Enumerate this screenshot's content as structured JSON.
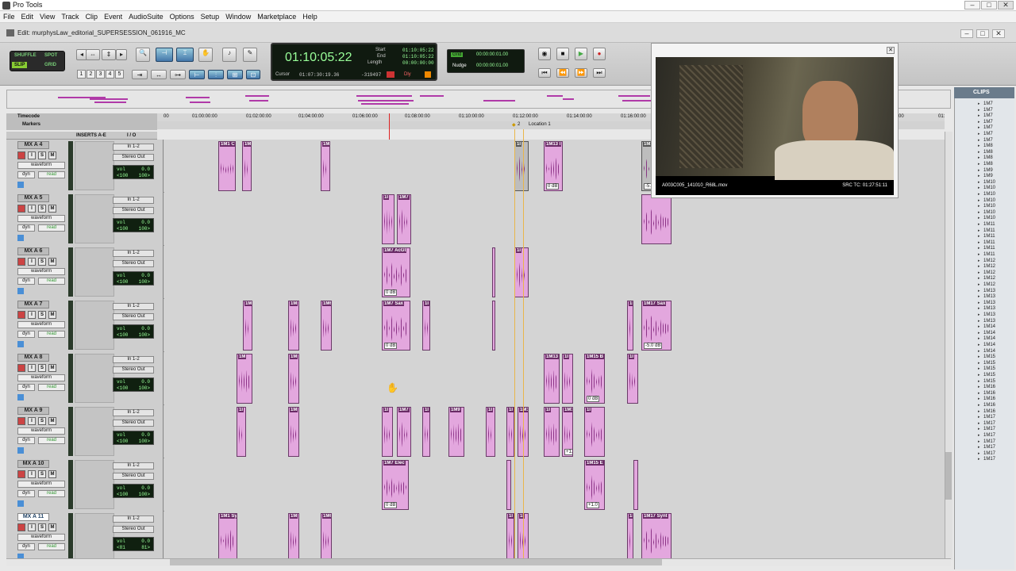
{
  "window": {
    "title": "Pro Tools",
    "edit_title": "Edit: murphysLaw_editorial_SUPERSESSION_061916_MC"
  },
  "menu": [
    "File",
    "Edit",
    "View",
    "Track",
    "Clip",
    "Event",
    "AudioSuite",
    "Options",
    "Setup",
    "Window",
    "Marketplace",
    "Help"
  ],
  "modes": {
    "shuffle": "SHUFFLE",
    "spot": "SPOT",
    "slip": "SLIP",
    "grid": "GRID"
  },
  "zoom_presets": [
    "1",
    "2",
    "3",
    "4",
    "5"
  ],
  "counter": {
    "main": "01:10:05:22",
    "start_label": "Start",
    "end_label": "End",
    "length_label": "Length",
    "start": "01:10:05:22",
    "end": "01:10:05:22",
    "length": "00:00:00:00",
    "cursor_label": "Cursor",
    "cursor": "01:07:30:19.36",
    "sample": "-319497",
    "dly_label": "Dly"
  },
  "grid": {
    "grid_label": "Grid",
    "grid_value": "00:00:00:01.00",
    "nudge_label": "Nudge",
    "nudge_value": "00:00:00:01.00"
  },
  "rulers": {
    "timecode_label": "Timecode",
    "markers_label": "Markers",
    "location": "2",
    "location_name": "Location 1",
    "ticks": [
      "00",
      "01:00:00:00",
      "01:02:00:00",
      "01:04:00:00",
      "01:06:00:00",
      "01:08:00:00",
      "01:10:00:00",
      "01:12:00:00",
      "01:14:00:00",
      "01:16:00:00",
      "00",
      "01:"
    ]
  },
  "columns": {
    "inserts": "INSERTS A-E",
    "io": "I / O"
  },
  "tracks": [
    {
      "name": "MX A 4",
      "input": "In 1-2",
      "output": "Stereo Out",
      "vol": "0.0",
      "pan_l": "<100",
      "pan_r": "100>",
      "selected": false
    },
    {
      "name": "MX A 5",
      "input": "In 1-2",
      "output": "Stereo Out",
      "vol": "0.0",
      "pan_l": "<100",
      "pan_r": "100>",
      "selected": false
    },
    {
      "name": "MX A 6",
      "input": "In 1-2",
      "output": "Stereo Out",
      "vol": "0.0",
      "pan_l": "<100",
      "pan_r": "100>",
      "selected": false
    },
    {
      "name": "MX A 7",
      "input": "In 1-2",
      "output": "Stereo Out",
      "vol": "0.0",
      "pan_l": "<100",
      "pan_r": "100>",
      "selected": false
    },
    {
      "name": "MX A 8",
      "input": "In 1-2",
      "output": "Stereo Out",
      "vol": "0.0",
      "pan_l": "<100",
      "pan_r": "100>",
      "selected": false
    },
    {
      "name": "MX A 9",
      "input": "In 1-2",
      "output": "Stereo Out",
      "vol": "0.0",
      "pan_l": "<100",
      "pan_r": "100>",
      "selected": false
    },
    {
      "name": "MX A 10",
      "input": "In 1-2",
      "output": "Stereo Out",
      "vol": "0.0",
      "pan_l": "<100",
      "pan_r": "100>",
      "selected": false
    },
    {
      "name": "MX A 11",
      "input": "In 1-2",
      "output": "Stereo Out",
      "vol": "0.0",
      "pan_l": "<81",
      "pan_r": "81>",
      "selected": true
    }
  ],
  "track_labels": {
    "view": "waveform",
    "dyn": "dyn",
    "read": "read",
    "vol": "vol",
    "r": "I",
    "s": "S",
    "m": "M"
  },
  "clips": {
    "t0": [
      {
        "n": "1M1 C"
      },
      {
        "n": "1M"
      },
      {
        "n": "1M"
      },
      {
        "n": "1I",
        "g": "gray"
      },
      {
        "n": "1M13 I",
        "gain": "0 dB"
      },
      {
        "n": "1M17 Elec",
        "gain": "-5.7 dB",
        "g": "gray"
      }
    ],
    "t1": [
      {
        "n": "1I"
      },
      {
        "n": "1M7"
      },
      {
        "n": ""
      }
    ],
    "t2": [
      {
        "n": "1M7 AcGt",
        "gain": "0 dB"
      },
      {
        "n": ""
      },
      {
        "n": "1I"
      }
    ],
    "t3": [
      {
        "n": "1M"
      },
      {
        "n": "1M"
      },
      {
        "n": "1M6"
      },
      {
        "n": "1M7 Sax",
        "gain": "0 dB"
      },
      {
        "n": "1I"
      },
      {
        "n": ""
      },
      {
        "n": "1I"
      },
      {
        "n": "1M17 Sax",
        "gain": "-5.0 dB"
      }
    ],
    "t4": [
      {
        "n": "1M"
      },
      {
        "n": "1M"
      },
      {
        "n": "1M13"
      },
      {
        "n": "1I"
      },
      {
        "n": "1M15 B",
        "gain": "0 dB"
      },
      {
        "n": "1I"
      }
    ],
    "t5": [
      {
        "n": "1I"
      },
      {
        "n": "1M"
      },
      {
        "n": "1I"
      },
      {
        "n": "1M7"
      },
      {
        "n": "1I"
      },
      {
        "n": "1M9"
      },
      {
        "n": "1I"
      },
      {
        "n": "1I"
      },
      {
        "n": "1M13"
      },
      {
        "n": "1I"
      },
      {
        "n": "1M15 S",
        "gain": "+1.9"
      },
      {
        "n": "1I"
      }
    ],
    "t6": [
      {
        "n": "1M7 Elec",
        "gain": "0 dB"
      },
      {
        "n": ""
      },
      {
        "n": "1M15 E",
        "gain": "+1.0"
      },
      {
        "n": ""
      }
    ],
    "t7": [
      {
        "n": "1M1 Sy"
      },
      {
        "n": "1M"
      },
      {
        "n": "1M6"
      },
      {
        "n": "1I"
      },
      {
        "n": "1I"
      },
      {
        "n": "1I"
      },
      {
        "n": "1M17 Synt"
      }
    ]
  },
  "clips_pane": {
    "title": "CLIPS",
    "items": [
      "1M7",
      "1M7",
      "1M7",
      "1M7",
      "1M7",
      "1M7",
      "1M7",
      "1M8",
      "1M8",
      "1M8",
      "1M8",
      "1M9",
      "1M9",
      "1M10",
      "1M10",
      "1M10",
      "1M10",
      "1M10",
      "1M10",
      "1M10",
      "1M11",
      "1M11",
      "1M11",
      "1M11",
      "1M11",
      "1M11",
      "1M12",
      "1M12",
      "1M12",
      "1M12",
      "1M12",
      "1M13",
      "1M13",
      "1M13",
      "1M13",
      "1M13",
      "1M13",
      "1M14",
      "1M14",
      "1M14",
      "1M14",
      "1M14",
      "1M15",
      "1M15",
      "1M15",
      "1M15",
      "1M15",
      "1M16",
      "1M16",
      "1M16",
      "1M16",
      "1M16",
      "1M17",
      "1M17",
      "1M17",
      "1M17",
      "1M17",
      "1M17",
      "1M17",
      "1M17"
    ]
  },
  "video": {
    "clip": "A003C005_141010_R68L.mov",
    "src_tc": "SRC TC: 01:27:51:11"
  },
  "colors": {
    "clip": "#e3a7de",
    "clip_border": "#6a3a68",
    "counter_text": "#99ff99",
    "selection": "#246"
  }
}
